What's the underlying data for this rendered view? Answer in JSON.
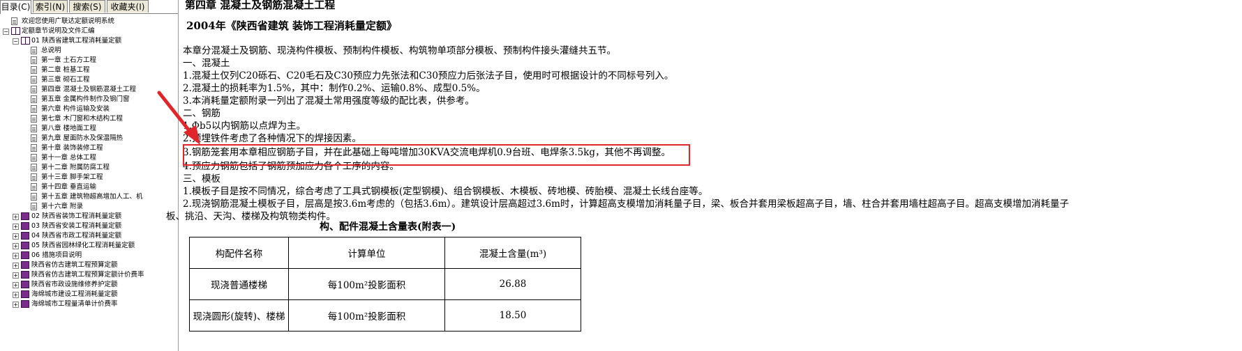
{
  "tabs": [
    {
      "label": "目录(C)",
      "active": true
    },
    {
      "label": "索引(N)",
      "active": false
    },
    {
      "label": "搜索(S)",
      "active": false
    },
    {
      "label": "收藏夹(I)",
      "active": false
    }
  ],
  "tree": [
    {
      "label": "欢迎您使用广联达定额说明系统",
      "indent": 0,
      "icon": "doc",
      "expander": ""
    },
    {
      "label": "定额章节说明及文件汇编",
      "indent": 0,
      "icon": "bookopen",
      "expander": "−"
    },
    {
      "label": "01 陕西省建筑工程消耗量定额",
      "indent": 1,
      "icon": "bookopen",
      "expander": "−"
    },
    {
      "label": "总说明",
      "indent": 2,
      "icon": "doc",
      "expander": ""
    },
    {
      "label": "第一章  土石方工程",
      "indent": 2,
      "icon": "doc",
      "expander": ""
    },
    {
      "label": "第二章  桩基工程",
      "indent": 2,
      "icon": "doc",
      "expander": ""
    },
    {
      "label": "第三章  砌石工程",
      "indent": 2,
      "icon": "doc",
      "expander": ""
    },
    {
      "label": "第四章  混凝土及钢筋混凝土工程",
      "indent": 2,
      "icon": "doc",
      "expander": ""
    },
    {
      "label": "第五章  金属构件制作及钢门窗",
      "indent": 2,
      "icon": "doc",
      "expander": ""
    },
    {
      "label": "第六章  构件运输及安装",
      "indent": 2,
      "icon": "doc",
      "expander": ""
    },
    {
      "label": "第七章  木门窗和木结构工程",
      "indent": 2,
      "icon": "doc",
      "expander": ""
    },
    {
      "label": "第八章  楼地面工程",
      "indent": 2,
      "icon": "doc",
      "expander": ""
    },
    {
      "label": "第九章  屋面防水及保温隔热",
      "indent": 2,
      "icon": "doc",
      "expander": ""
    },
    {
      "label": "第十章  装饰装修工程",
      "indent": 2,
      "icon": "doc",
      "expander": ""
    },
    {
      "label": "第十一章  总体工程",
      "indent": 2,
      "icon": "doc",
      "expander": ""
    },
    {
      "label": "第十二章  附属防腐工程",
      "indent": 2,
      "icon": "doc",
      "expander": ""
    },
    {
      "label": "第十三章  脚手架工程",
      "indent": 2,
      "icon": "doc",
      "expander": ""
    },
    {
      "label": "第十四章  垂直运输",
      "indent": 2,
      "icon": "doc",
      "expander": ""
    },
    {
      "label": "第十五章  建筑物超高增加人工、机",
      "indent": 2,
      "icon": "doc",
      "expander": ""
    },
    {
      "label": "第十六章  附录",
      "indent": 2,
      "icon": "doc",
      "expander": ""
    },
    {
      "label": "02 陕西省装饰工程消耗量定额",
      "indent": 1,
      "icon": "book",
      "expander": "+"
    },
    {
      "label": "03 陕西省安装工程消耗量定额",
      "indent": 1,
      "icon": "book",
      "expander": "+"
    },
    {
      "label": "04 陕西省市政工程消耗量定额",
      "indent": 1,
      "icon": "book",
      "expander": "+"
    },
    {
      "label": "05 陕西省园林绿化工程消耗量定额",
      "indent": 1,
      "icon": "book",
      "expander": "+"
    },
    {
      "label": "06 措施项目说明",
      "indent": 1,
      "icon": "book",
      "expander": "+"
    },
    {
      "label": "陕西省仿古建筑工程预算定额",
      "indent": 1,
      "icon": "book",
      "expander": "+"
    },
    {
      "label": "陕西省仿古建筑工程预算定额计价费率",
      "indent": 1,
      "icon": "book",
      "expander": "+"
    },
    {
      "label": "陕西省市政设施维修养护定额",
      "indent": 1,
      "icon": "book",
      "expander": "+"
    },
    {
      "label": "海绵城市建设工程消耗量定额",
      "indent": 1,
      "icon": "book",
      "expander": "+"
    },
    {
      "label": "海绵城市工程量清单计价费率",
      "indent": 1,
      "icon": "book",
      "expander": "+"
    }
  ],
  "content": {
    "chapter_title": "第四章   混凝土及钢筋混凝土工程",
    "quota_title": "2004年《陕西省建筑 装饰工程消耗量定额》",
    "lines": [
      "本章分混凝土及钢筋、现浇构件模板、预制构件模板、构筑物单项部分模板、预制构件接头灌缝共五节。",
      "一、混凝土",
      "1.混凝土仅列C20砾石、C20毛石及C30预应力先张法和C30预应力后张法子目，使用时可根据设计的不同标号列入。",
      "2.混凝土的损耗率为1.5%，其中：制作0.2%、运输0.8%、成型0.5%。",
      "3.本消耗量定额附录一列出了混凝土常用强度等级的配比表，供参考。",
      "二、钢筋",
      "1.Φb5以内钢筋以点焊为主。",
      "2.预埋铁件考虑了各种情况下的焊接因素。",
      "3.钢筋笼套用本章相应钢筋子目，并在此基础上每吨增加30KVA交流电焊机0.9台班、电焊条3.5kg，其他不再调整。",
      "4.预应力钢筋包括了钢筋预加应力各个工序的内容。",
      "三、模板",
      "1.模板子目是按不同情况，综合考虑了工具式钢模板(定型钢模)、组合钢模板、木模板、砖地模、砖胎模、混凝土长线台座等。",
      "2.现浇钢筋混凝土模板子目，层高是按3.6m考虑的（包括3.6m）。建筑设计层高超过3.6m时，计算超高支模增加消耗量子目，梁、板合并套用梁板超高子目，墙、柱合并套用墙柱超高子目。超高支模增加消耗量子",
      "板、挑沿、天沟、楼梯及构筑物类构件。"
    ],
    "table_caption": "构、配件混凝土含量表(附表一)",
    "table_header": [
      "构配件名称",
      "计算单位",
      "混凝土含量(m³)"
    ],
    "table_rows": [
      [
        "现浇普通楼梯",
        "每100m²投影面积",
        "26.88"
      ],
      [
        "现浇圆形(旋转)、楼梯",
        "每100m²投影面积",
        "18.50"
      ]
    ]
  },
  "colors": {
    "highlight": "#e0262a",
    "arrow": "#e0262a"
  }
}
